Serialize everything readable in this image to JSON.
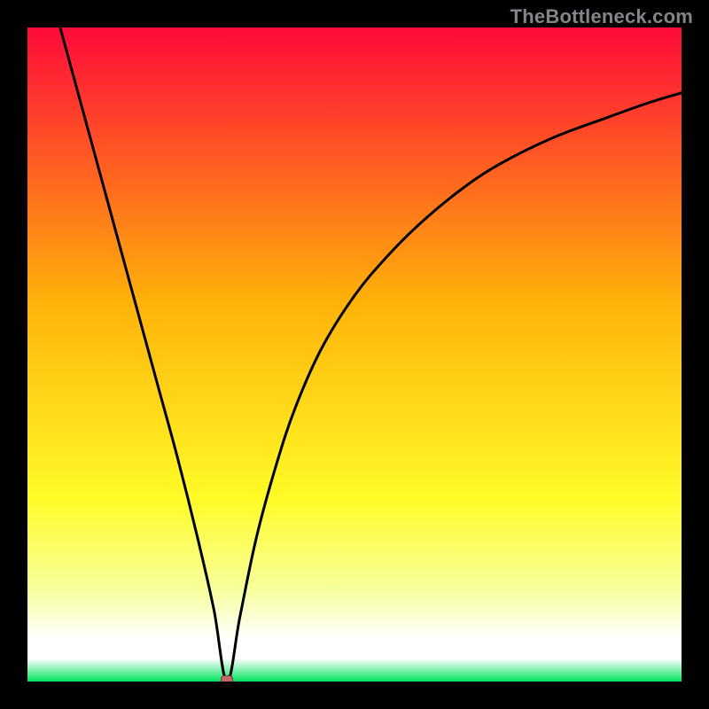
{
  "watermark": "TheBottleneck.com",
  "colors": {
    "top": "#ff0a3a",
    "mid": "#ffb20a",
    "yellow": "#fffb27",
    "pale": "#f7ff9d",
    "white": "#ffffff",
    "green": "#00e35c",
    "curve": "#000000",
    "marker": "#c7686a",
    "markerBorder": "#6e3a3c"
  },
  "gradient_stops": [
    {
      "offset": 0.0,
      "color_key": "top"
    },
    {
      "offset": 0.42,
      "color_key": "mid"
    },
    {
      "offset": 0.72,
      "color_key": "yellow"
    },
    {
      "offset": 0.86,
      "color_key": "pale"
    },
    {
      "offset": 0.935,
      "color_key": "white"
    },
    {
      "offset": 0.965,
      "color_key": "white"
    },
    {
      "offset": 1.0,
      "color_key": "green"
    }
  ],
  "chart_data": {
    "type": "line",
    "title": "",
    "xlabel": "",
    "ylabel": "",
    "xlim": [
      0,
      100
    ],
    "ylim": [
      0,
      100
    ],
    "min_point": {
      "x": 30.5,
      "y": 0
    },
    "series": [
      {
        "name": "bottleneck-curve",
        "x": [
          5,
          8,
          11,
          14,
          17,
          20,
          23,
          26,
          28.5,
          30.5,
          32.5,
          35,
          38,
          41,
          45,
          50,
          55,
          60,
          66,
          72,
          80,
          88,
          95,
          100
        ],
        "values": [
          100,
          89,
          78,
          67,
          56,
          45,
          34,
          22,
          11,
          0,
          10,
          22,
          33,
          42,
          51,
          59,
          65,
          70,
          75,
          79,
          83,
          86,
          88.5,
          90
        ]
      }
    ]
  }
}
